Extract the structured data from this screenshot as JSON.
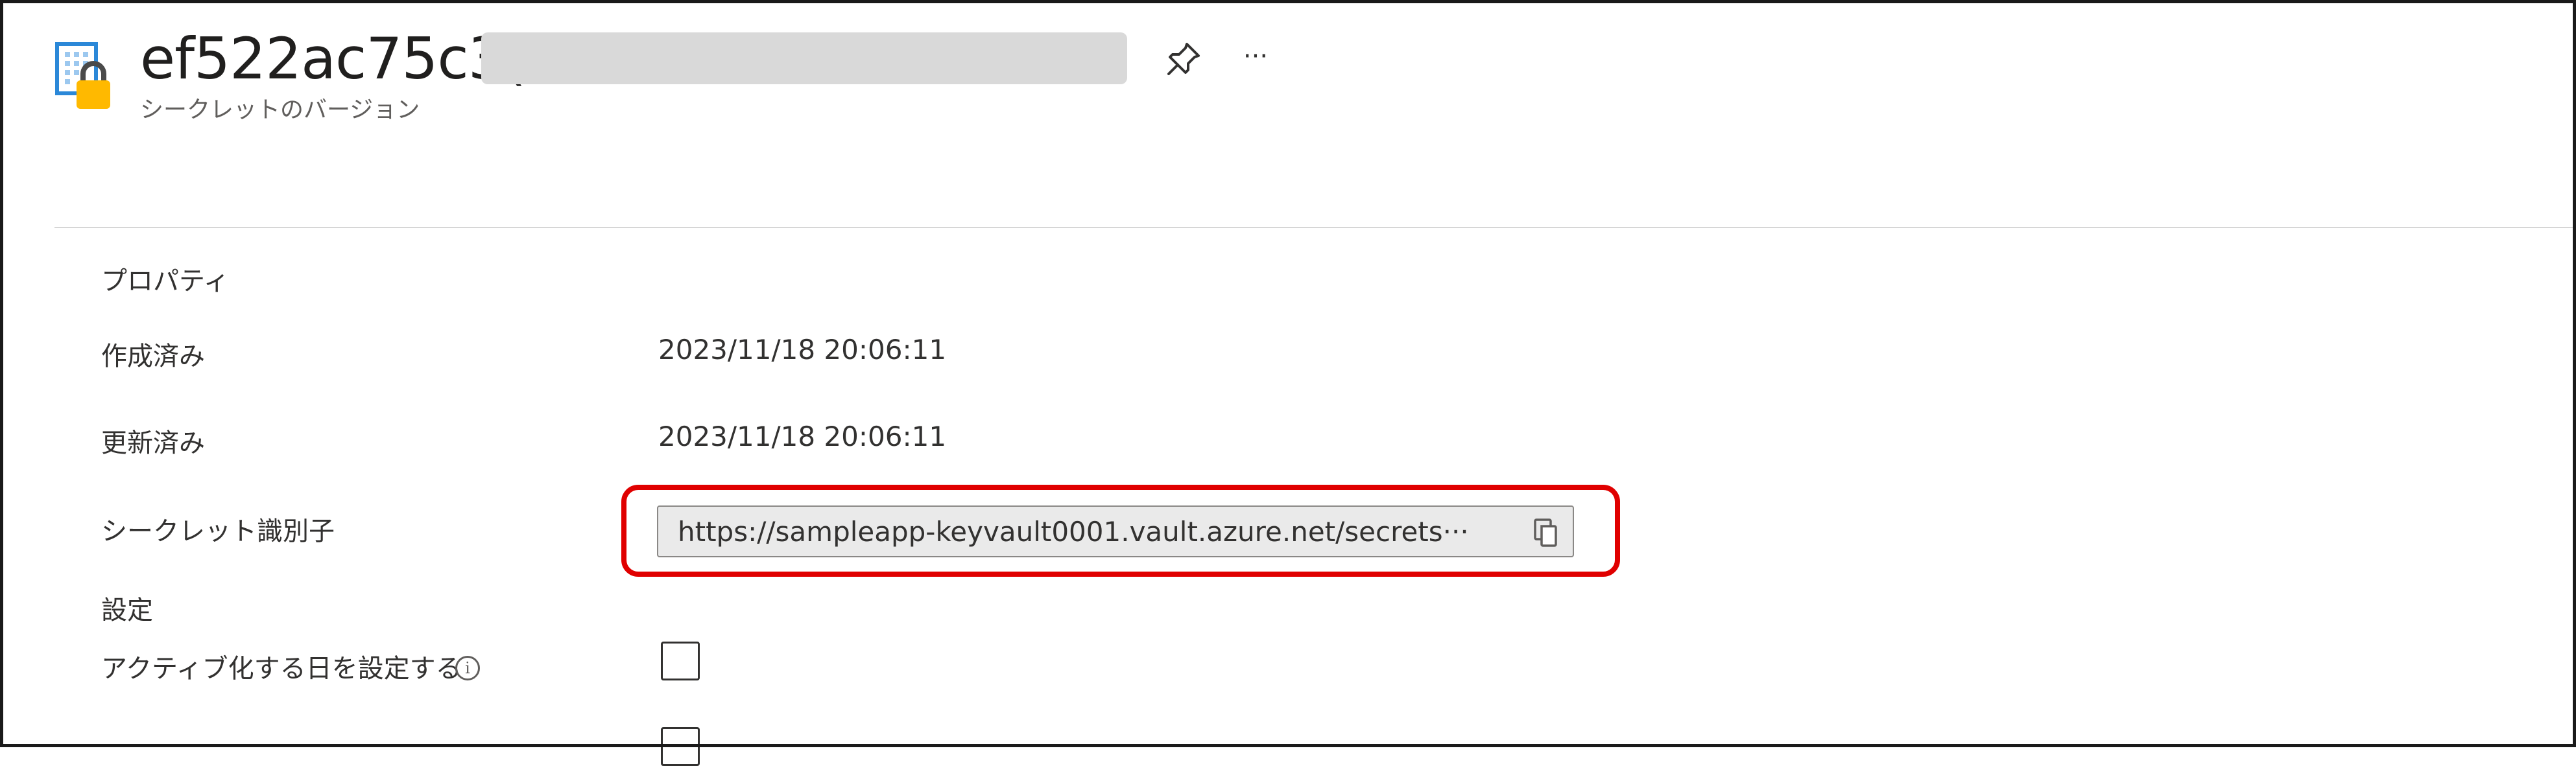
{
  "header": {
    "title": "ef522ac75c3(",
    "subtitle": "シークレットのバージョン",
    "icons": {
      "resource": "key-vault-secret-lock-icon",
      "pin": "pin-icon",
      "more": "more-options-icon"
    },
    "more_label": "···"
  },
  "properties": {
    "heading": "プロパティ",
    "created_label": "作成済み",
    "created_value": "2023/11/18 20:06:11",
    "updated_label": "更新済み",
    "updated_value": "2023/11/18 20:06:11",
    "secret_id_label": "シークレット識別子",
    "secret_id_value": "https://sampleapp-keyvault0001.vault.azure.net/secrets···",
    "copy_icon": "copy-icon"
  },
  "settings": {
    "heading": "設定",
    "activation_label": "アクティブ化する日を設定する",
    "activation_checked": false,
    "info_icon": "info-icon",
    "info_glyph": "i",
    "expiration_checked": false
  },
  "colors": {
    "highlight": "#e00000",
    "field_bg": "#eaeaea",
    "redaction": "#d9d9d9"
  }
}
